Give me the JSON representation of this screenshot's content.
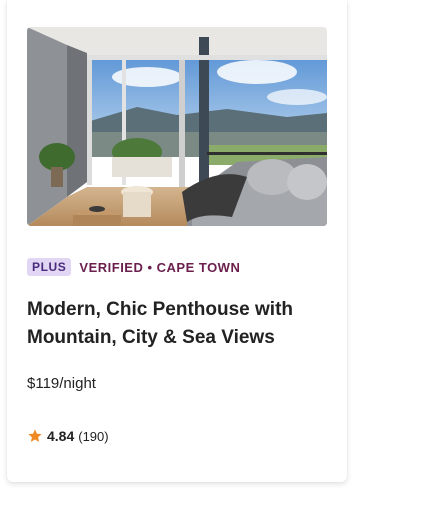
{
  "listing": {
    "badge": "PLUS",
    "verified_location": "VERIFIED • CAPE TOWN",
    "title": "Modern, Chic Penthouse with Mountain, City & Sea Views",
    "price": "$119/night",
    "rating": "4.84",
    "review_count": "(190)",
    "photo_icon": "listing-photo",
    "star_icon": "star-icon",
    "colors": {
      "badge_bg": "#e2d6f5",
      "verified_text": "#6a1f4d",
      "star": "#f08a24"
    }
  }
}
